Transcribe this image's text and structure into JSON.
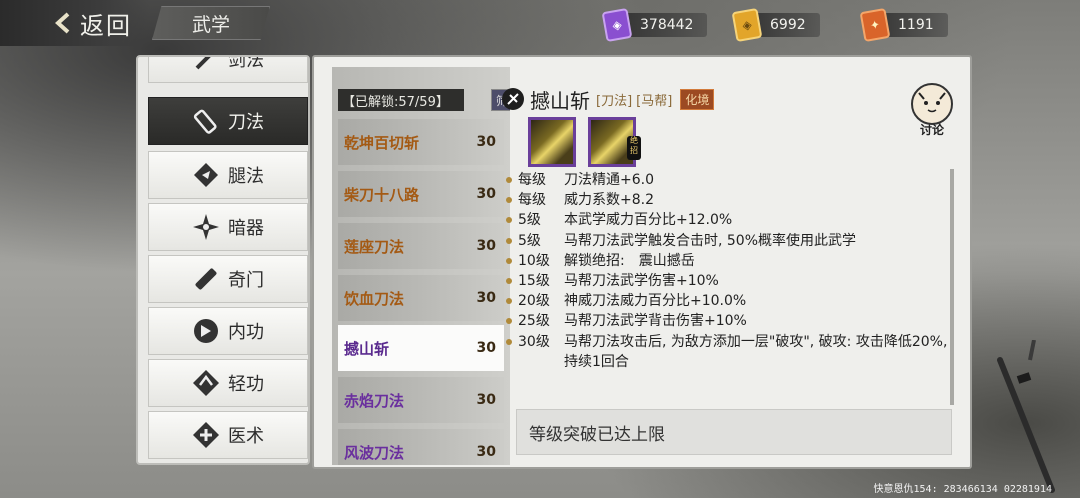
{
  "header": {
    "back_label": "返回",
    "title": "武学"
  },
  "currencies": [
    {
      "name": "purple-token",
      "value": "378442",
      "color": "#8a4fd0"
    },
    {
      "name": "gold-token",
      "value": "6992",
      "color": "#e2a52a"
    },
    {
      "name": "fire-token",
      "value": "1191",
      "color": "#d9642a"
    }
  ],
  "sidebar": {
    "items": [
      {
        "label": "剑法",
        "icon": "sword-icon"
      },
      {
        "label": "刀法",
        "icon": "blade-icon",
        "active": true
      },
      {
        "label": "腿法",
        "icon": "kick-icon"
      },
      {
        "label": "暗器",
        "icon": "shuriken-icon"
      },
      {
        "label": "奇门",
        "icon": "odd-weapon-icon"
      },
      {
        "label": "内功",
        "icon": "inner-power-icon"
      },
      {
        "label": "轻功",
        "icon": "qinggong-icon"
      },
      {
        "label": "医术",
        "icon": "medicine-icon"
      }
    ]
  },
  "skill_list": {
    "unlock_label": "【已解锁:57/59】",
    "filter_label": "筛",
    "items": [
      {
        "name": "乾坤百切斩",
        "level": "30",
        "color": "orange"
      },
      {
        "name": "柴刀十八路",
        "level": "30",
        "color": "orange"
      },
      {
        "name": "莲座刀法",
        "level": "30",
        "color": "orange"
      },
      {
        "name": "饮血刀法",
        "level": "30",
        "color": "orange"
      },
      {
        "name": "撼山斩",
        "level": "30",
        "color": "purple",
        "active": true
      },
      {
        "name": "赤焰刀法",
        "level": "30",
        "color": "purple"
      },
      {
        "name": "风波刀法",
        "level": "30",
        "color": "purple"
      }
    ]
  },
  "detail": {
    "name": "撼山斩",
    "type_tag": "[刀法]",
    "school_tag": "[马帮]",
    "realm_tag": "化境",
    "discuss_label": "讨论",
    "ult_badge": "绝招",
    "effects": [
      {
        "level": "每级",
        "text": "刀法精通+6.0"
      },
      {
        "level": "每级",
        "text": "威力系数+8.2"
      },
      {
        "level": "5级",
        "text": "本武学威力百分比+12.0%"
      },
      {
        "level": "5级",
        "text": "马帮刀法武学触发合击时, 50%概率使用此武学"
      },
      {
        "level": "10级",
        "text": "解锁绝招:　震山撼岳"
      },
      {
        "level": "15级",
        "text": "马帮刀法武学伤害+10%"
      },
      {
        "level": "20级",
        "text": "神威刀法威力百分比+10.0%"
      },
      {
        "level": "25级",
        "text": "马帮刀法武学背击伤害+10%"
      },
      {
        "level": "30级",
        "text": "马帮刀法攻击后, 为敌方添加一层\"破攻\", 破攻: 攻击降低20%, 持续1回合"
      }
    ],
    "status": "等级突破已达上限"
  },
  "footer": "快意恩仇154: 283466134 02281914"
}
